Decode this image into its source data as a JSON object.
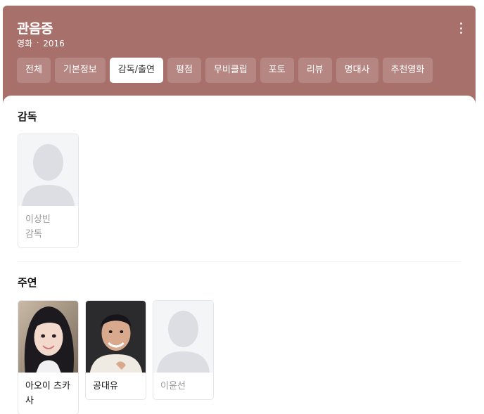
{
  "header": {
    "title": "관음증",
    "category": "영화",
    "year": "2016"
  },
  "tabs": [
    {
      "label": "전체",
      "active": false
    },
    {
      "label": "기본정보",
      "active": false
    },
    {
      "label": "감독/출연",
      "active": true
    },
    {
      "label": "평점",
      "active": false
    },
    {
      "label": "무비클립",
      "active": false
    },
    {
      "label": "포토",
      "active": false
    },
    {
      "label": "리뷰",
      "active": false
    },
    {
      "label": "명대사",
      "active": false
    },
    {
      "label": "추천영화",
      "active": false
    }
  ],
  "sections": {
    "director": {
      "title": "감독",
      "people": [
        {
          "name": "이상빈",
          "role": "감독",
          "photo": "placeholder-silhouette"
        }
      ]
    },
    "cast": {
      "title": "주연",
      "people": [
        {
          "name": "아오이 츠카사",
          "photo": "actress-photo"
        },
        {
          "name": "공대유",
          "photo": "actor-photo"
        },
        {
          "name": "이윤선",
          "photo": "placeholder-silhouette"
        }
      ]
    }
  },
  "colors": {
    "header_bg": "#a8706a",
    "tab_active_bg": "#ffffff",
    "placeholder_bg": "#f4f5f7",
    "silhouette": "#dcdee3"
  }
}
